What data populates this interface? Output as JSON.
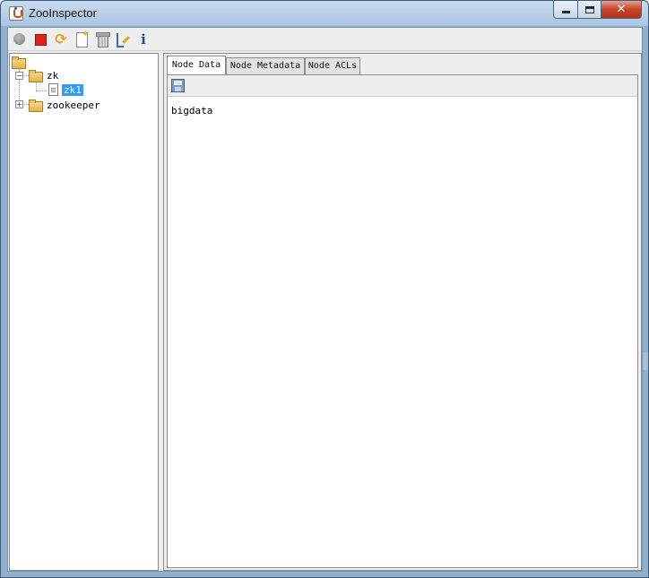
{
  "window": {
    "title": "ZooInspector",
    "controls": {
      "minimize": "–",
      "maximize": "☐",
      "close": "✕"
    }
  },
  "toolbar": {
    "buttons": [
      {
        "id": "connect",
        "icon": "connect-icon"
      },
      {
        "id": "disconnect",
        "icon": "disconnect-icon"
      },
      {
        "id": "refresh",
        "icon": "refresh-icon"
      },
      {
        "id": "add-node",
        "icon": "add-node-icon"
      },
      {
        "id": "delete-node",
        "icon": "delete-node-icon"
      },
      {
        "id": "node-viewers",
        "icon": "edit-viewers-icon"
      },
      {
        "id": "about",
        "icon": "info-icon",
        "glyph": "i"
      }
    ]
  },
  "tree": {
    "root": {
      "icon": "open-folder-icon"
    },
    "nodes": [
      {
        "label": "zk",
        "expanded": true,
        "children": [
          {
            "label": "zk1",
            "selected": true
          }
        ]
      },
      {
        "label": "zookeeper",
        "expanded": false
      }
    ]
  },
  "tabs": [
    {
      "label": "Node Data",
      "active": true
    },
    {
      "label": "Node Metadata",
      "active": false
    },
    {
      "label": "Node ACLs",
      "active": false
    }
  ],
  "node_data": {
    "content": "bigdata"
  }
}
